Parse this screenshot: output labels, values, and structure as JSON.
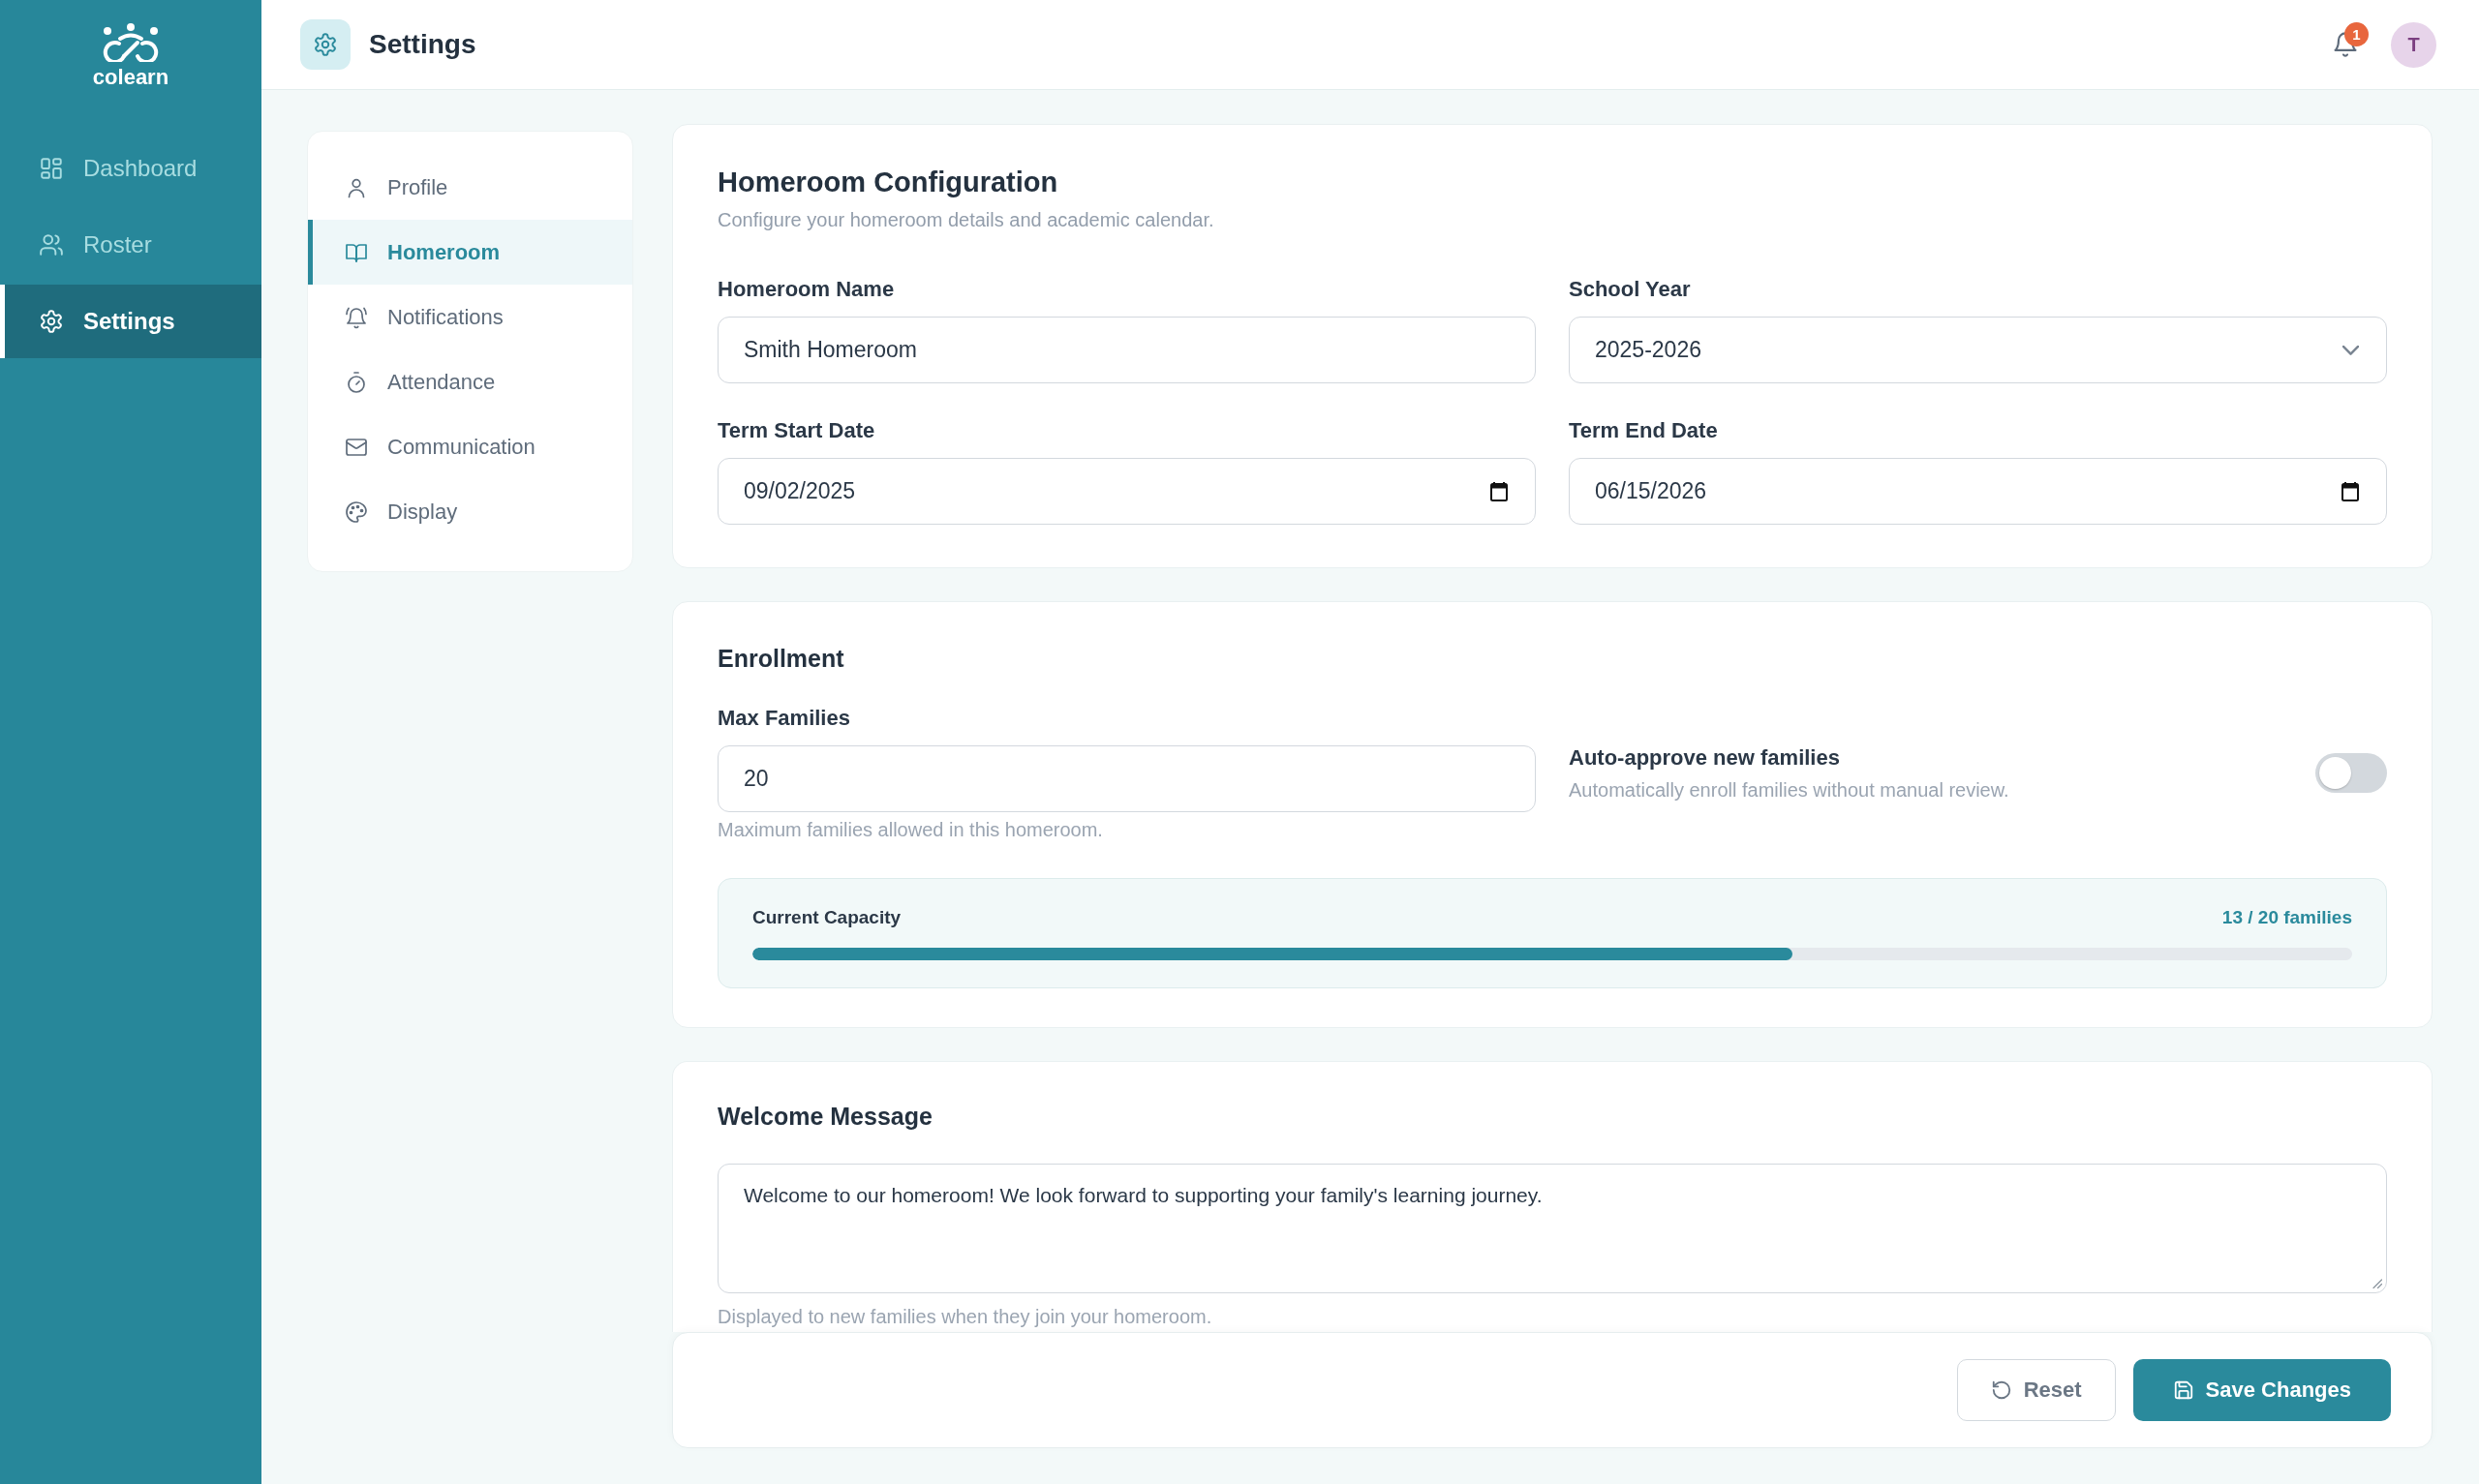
{
  "sidebar": {
    "logo_text": "colearn",
    "items": [
      {
        "label": "Dashboard",
        "selected": false
      },
      {
        "label": "Roster",
        "selected": false
      },
      {
        "label": "Settings",
        "selected": true
      }
    ]
  },
  "header": {
    "title": "Settings",
    "notification_count": "1",
    "avatar": "T"
  },
  "settings_nav": [
    {
      "label": "Profile",
      "selected": false
    },
    {
      "label": "Homeroom",
      "selected": true
    },
    {
      "label": "Notifications",
      "selected": false
    },
    {
      "label": "Attendance",
      "selected": false
    },
    {
      "label": "Communication",
      "selected": false
    },
    {
      "label": "Display",
      "selected": false
    }
  ],
  "homeroom_configuration": {
    "title": "Homeroom Configuration",
    "subtitle": "Configure your homeroom details and academic calendar.",
    "fields": [
      {
        "kind": "text",
        "label": "Homeroom Name",
        "value": "Smith Homeroom"
      },
      {
        "kind": "select",
        "label": "School Year",
        "value": "2025-2026"
      },
      {
        "kind": "date",
        "label": "Term Start Date",
        "value": "09/02/2025"
      },
      {
        "kind": "date",
        "label": "Term End Date",
        "value": "06/15/2026"
      }
    ]
  },
  "enrollment": {
    "title": "Enrollment",
    "max_families": {
      "label": "Max Families",
      "value": "20",
      "help_text": "Maximum families allowed in this homeroom."
    },
    "auto_approve": {
      "label": "Auto-approve new families",
      "description": "Automatically enroll families without manual review.",
      "on": false
    },
    "capacity": {
      "label": "Current Capacity",
      "reading": "13 / 20 families",
      "level": 0.65
    }
  },
  "welcome_message": {
    "title": "Welcome Message",
    "value": "Welcome to our homeroom! We look forward to supporting your family's learning journey.",
    "help_text": "Displayed to new families when they join your homeroom."
  },
  "actions": [
    {
      "kind": "reset",
      "label": "Reset"
    },
    {
      "kind": "save",
      "label": "Save Changes"
    }
  ]
}
